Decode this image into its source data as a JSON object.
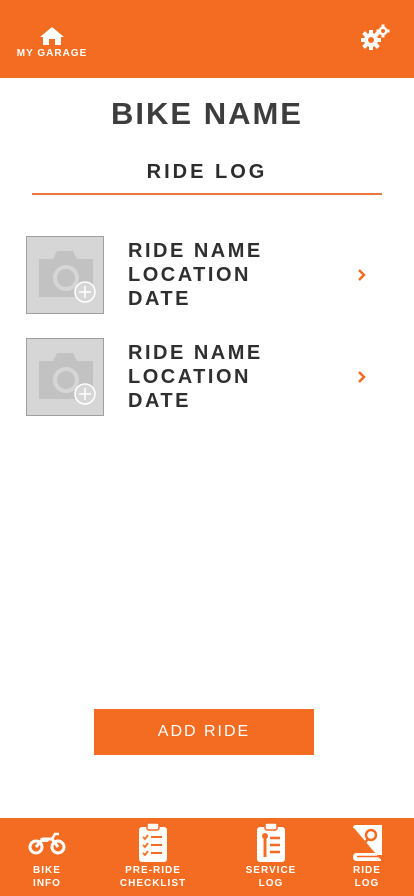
{
  "header": {
    "garage_label": "MY GARAGE",
    "garage_icon": "home-icon",
    "settings_icon": "gears-icon"
  },
  "page": {
    "bike_name": "BIKE NAME",
    "section_title": "RIDE LOG"
  },
  "rides": [
    {
      "name": "RIDE NAME",
      "location": "LOCATION",
      "date": "DATE"
    },
    {
      "name": "RIDE NAME",
      "location": "LOCATION",
      "date": "DATE"
    }
  ],
  "actions": {
    "add_ride_label": "ADD RIDE"
  },
  "tabbar": {
    "tabs": [
      {
        "line1": "BIKE",
        "line2": "INFO",
        "icon": "motorcycle-icon"
      },
      {
        "line1": "PRE-RIDE",
        "line2": "CHECKLIST",
        "icon": "clipboard-checklist-icon"
      },
      {
        "line1": "SERVICE",
        "line2": "LOG",
        "icon": "service-clipboard-icon"
      },
      {
        "line1": "RIDE",
        "line2": "LOG",
        "icon": "ride-book-icon"
      }
    ]
  },
  "colors": {
    "accent": "#f36c21",
    "text": "#3d3d3d",
    "photo_placeholder": "#d6d6d6"
  }
}
